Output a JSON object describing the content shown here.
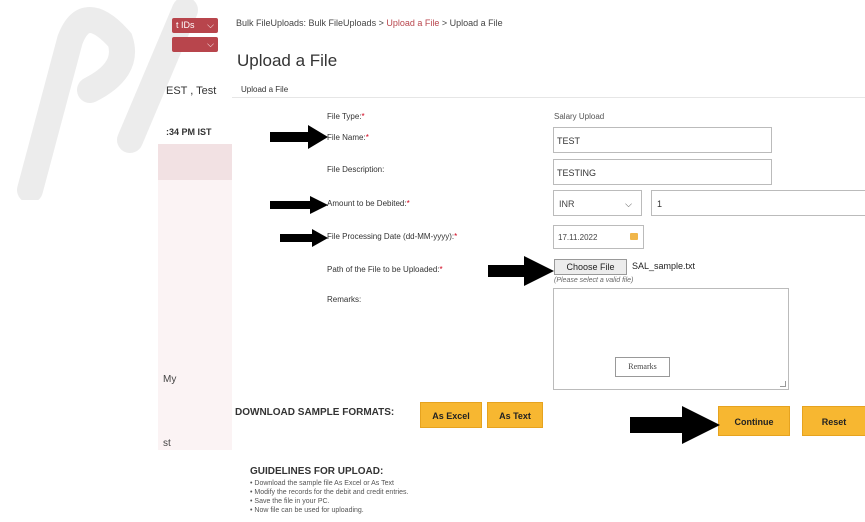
{
  "sidebar": {
    "select1": "t IDs",
    "user": "EST , Test",
    "time": ":34 PM IST",
    "menu_my": "My",
    "menu_st": "st"
  },
  "breadcrumb": {
    "part1": "Bulk FileUploads: Bulk FileUploads >",
    "link": "Upload a File",
    "part2": "> Upload a File"
  },
  "page": {
    "title": "Upload a File",
    "subtitle": "Upload a File"
  },
  "form": {
    "file_type_label": "File Type:",
    "file_type_value": "Salary Upload",
    "file_name_label": "File Name:",
    "file_name_value": "TEST",
    "file_desc_label": "File Description:",
    "file_desc_value": "TESTING",
    "amount_label": "Amount to be Debited:",
    "currency": "INR",
    "amount_value": "1",
    "date_label": "File Processing Date (dd-MM-yyyy):",
    "date_value": "17.11.2022",
    "path_label": "Path of the File to be Uploaded:",
    "choose_file": "Choose File",
    "chosen_file": "SAL_sample.txt",
    "hint": "(Please select a valid file)",
    "remarks_label": "Remarks:",
    "remarks_button": "Remarks"
  },
  "download": {
    "label": "DOWNLOAD SAMPLE FORMATS:",
    "excel": "As Excel",
    "text": "As Text"
  },
  "actions": {
    "continue": "Continue",
    "reset": "Reset"
  },
  "guidelines": {
    "heading": "GUIDELINES FOR UPLOAD:",
    "items": [
      "Download the sample file As Excel or As Text",
      "Modify the records for the debit and credit entries.",
      "Save the file in your PC.",
      "Now file can be used for uploading."
    ]
  },
  "colors": {
    "accent": "#b8454c",
    "button": "#f7b731",
    "required": "#d0021b"
  }
}
